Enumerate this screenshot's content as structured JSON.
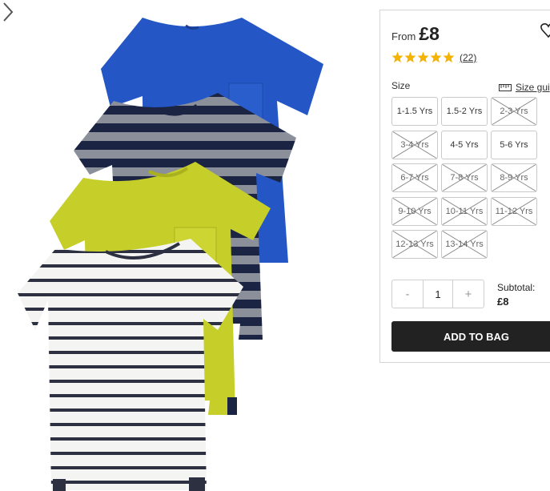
{
  "product": {
    "price_prefix": "From",
    "price": "£8",
    "rating_stars": 5,
    "review_count": "(22)"
  },
  "size": {
    "label": "Size",
    "guide_label": "Size gui",
    "options": [
      {
        "label": "1-1.5 Yrs",
        "available": true
      },
      {
        "label": "1.5-2 Yrs",
        "available": true
      },
      {
        "label": "2-3 Yrs",
        "available": false
      },
      {
        "label": "3-4 Yrs",
        "available": false
      },
      {
        "label": "4-5 Yrs",
        "available": true
      },
      {
        "label": "5-6 Yrs",
        "available": true
      },
      {
        "label": "6-7 Yrs",
        "available": false
      },
      {
        "label": "7-8 Yrs",
        "available": false
      },
      {
        "label": "8-9 Yrs",
        "available": false
      },
      {
        "label": "9-10 Yrs",
        "available": false
      },
      {
        "label": "10-11 Yrs",
        "available": false
      },
      {
        "label": "11-12 Yrs",
        "available": false
      },
      {
        "label": "12-13 Yrs",
        "available": false
      },
      {
        "label": "13-14 Yrs",
        "available": false
      }
    ]
  },
  "quantity": {
    "minus": "-",
    "value": "1",
    "plus": "+"
  },
  "subtotal": {
    "label": "Subtotal:",
    "value": "£8"
  },
  "cta": {
    "add_to_bag": "ADD TO BAG"
  },
  "icons": {
    "wishlist": "heart-icon",
    "rating": "star-icon",
    "size_guide": "ruler-icon",
    "next": "chevron-right-icon"
  },
  "colors": {
    "star": "#f5b301",
    "button": "#222222",
    "tee_blue": "#2457c5",
    "tee_navy": "#1c2444",
    "tee_lime": "#c6cf2a"
  }
}
